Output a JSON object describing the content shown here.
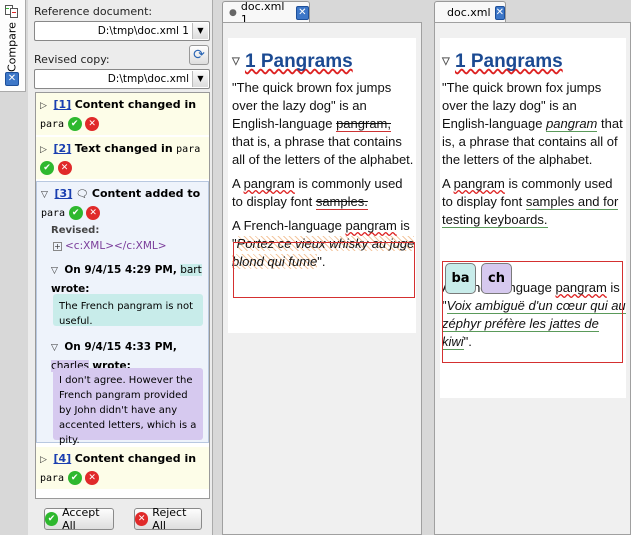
{
  "side_tab": {
    "label": "Compare"
  },
  "compare": {
    "reference_label": "Reference document:",
    "reference_value": "D:\\tmp\\doc.xml 1",
    "revised_label": "Revised copy:",
    "revised_value": "D:\\tmp\\doc.xml",
    "changes": [
      {
        "num": "[1]",
        "text": "Content changed in",
        "tag": "para"
      },
      {
        "num": "[2]",
        "text": "Text changed in",
        "tag": "para"
      },
      {
        "num": "[3]",
        "text": "Content added to",
        "tag": "para"
      },
      {
        "num": "[4]",
        "text": "Content changed in",
        "tag": "para"
      }
    ],
    "revised_heading": "Revised:",
    "revised_xml": "<c:XML></c:XML>",
    "comments": [
      {
        "date": "On 9/4/15 4:29 PM,",
        "author": "bart",
        "wrote": "wrote:",
        "text": "The French pangram is not useful.",
        "color": "#c8ecea"
      },
      {
        "date": "On 9/4/15 4:33 PM,",
        "author": "charles",
        "wrote": "wrote:",
        "text": "I don't agree. However the French pangram provided by John didn't have any accented letters, which is a pity.",
        "color": "#d6c9ef"
      }
    ],
    "accept_all": "Accept All",
    "reject_all": "Reject All"
  },
  "left_editor": {
    "tab_label": "doc.xml 1",
    "heading": "1 Pangrams",
    "p1_a": "\"The quick brown fox jumps over the lazy dog\" is an English-language ",
    "p1_del": "pangram,",
    "p1_b": " that is, a phrase that contains all of the letters of the alphabet.",
    "p2_a": "A ",
    "p2_word": "pangram",
    "p2_b": " is commonly used to display font ",
    "p2_del": "samples.",
    "p3_a": "A French-language ",
    "p3_word": "pangram",
    "p3_b": " is \"",
    "p3_quote": "Portez ce vieux whisky au juge blond qui fume",
    "p3_c": "\"."
  },
  "right_editor": {
    "tab_label": "doc.xml",
    "heading": "1 Pangrams",
    "p1_a": "\"The quick brown fox jumps over the lazy dog\" is an English-language ",
    "p1_ins": "pangram",
    "p1_b": " that is, a phrase that contains all of the letters of the alphabet.",
    "p2_a": "A ",
    "p2_word": "pangram",
    "p2_b": " is commonly used to display font ",
    "p2_ins": "samples and for testing keyboards.",
    "callout_1": "ba",
    "callout_2": "ch",
    "p3_a": "A French-language ",
    "p3_word": "pangram",
    "p3_b": " is \"",
    "p3_quote": "Voix ambiguë d'un cœur qui au zéphyr préfère les jattes de kiwi",
    "p3_c": "\"."
  },
  "colors": {
    "heading": "#1b4a92",
    "accept": "#2eb82e",
    "reject": "#e02a2a",
    "link": "#1a3fb0"
  }
}
